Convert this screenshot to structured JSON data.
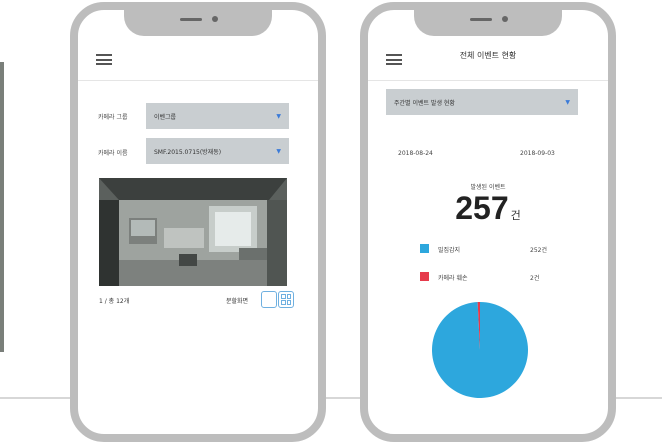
{
  "phone1": {
    "menu_icon": "hamburger-icon",
    "camera_group_label": "카메라 그룹",
    "camera_group_value": "이벤그룹",
    "camera_name_label": "카메라 이름",
    "camera_name_value": "SMF.2015.0715(방재동)",
    "page_label": "1 / 총 12개",
    "split_label": "분할화면",
    "colors": {
      "select_bg": "#c9ced1",
      "accent": "#3b7bd8"
    }
  },
  "phone2": {
    "menu_icon": "hamburger-icon",
    "title": "전체 이벤트 현황",
    "filter_value": "주간별 이벤트 발생 현황",
    "date_start": "2018-08-24",
    "date_end": "2018-09-03",
    "occurred_label": "발생된 이벤트",
    "total_count": "257",
    "total_unit": "건",
    "legend": [
      {
        "label": "밀집감지",
        "value": "252건",
        "color": "#2da7dd"
      },
      {
        "label": "카메라 훼손",
        "value": "2건",
        "color": "#e63b4c"
      }
    ],
    "chart_data": {
      "type": "pie",
      "categories": [
        "밀집감지",
        "카메라 훼손"
      ],
      "values": [
        252,
        2
      ],
      "colors": [
        "#2da7dd",
        "#e63b4c"
      ]
    }
  }
}
